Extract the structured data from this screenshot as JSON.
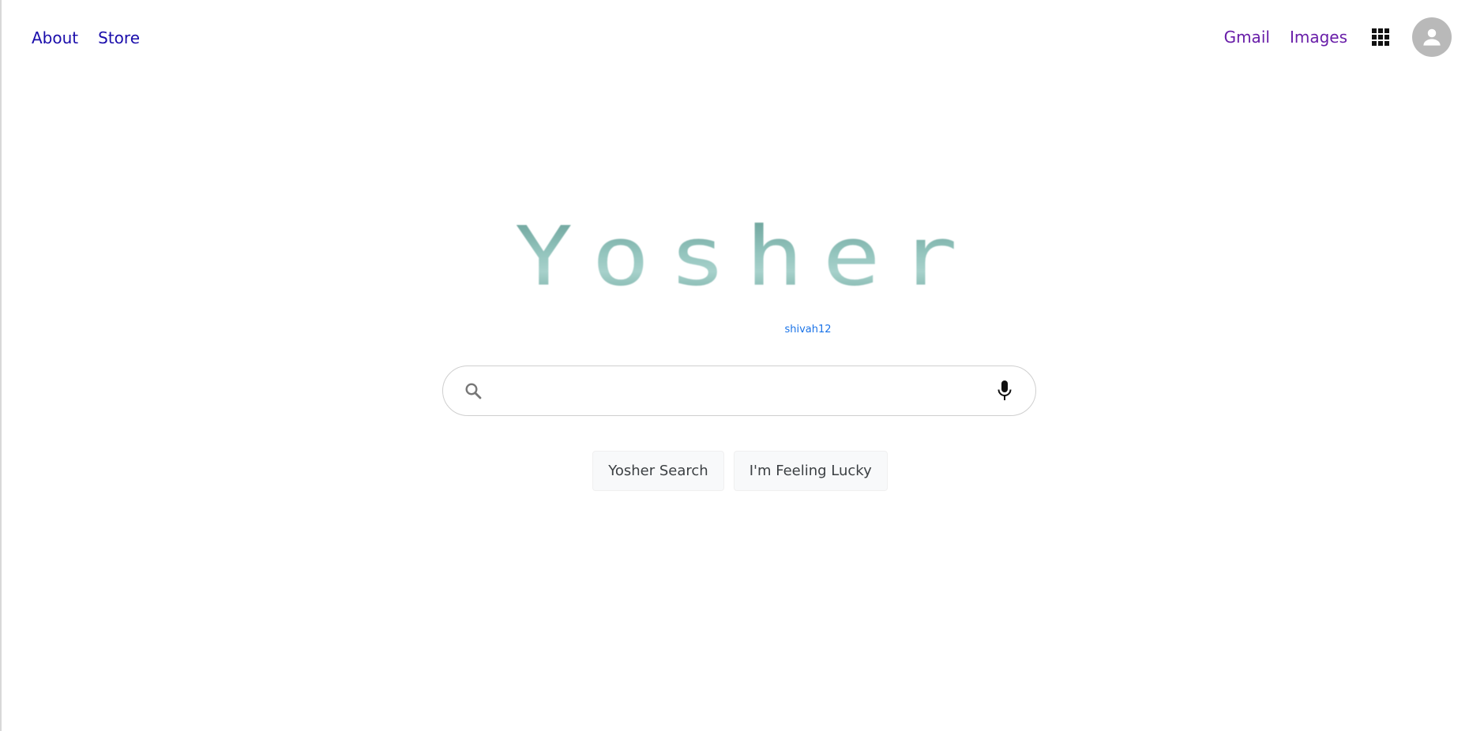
{
  "top_nav": {
    "about_label": "About",
    "store_label": "Store",
    "gmail_label": "Gmail",
    "images_label": "Images",
    "apps_icon": "apps-grid-icon",
    "avatar_icon": "account-icon"
  },
  "logo": {
    "text": "Yosher",
    "subtitle": "shivah12"
  },
  "search": {
    "value": "",
    "placeholder": "",
    "search_icon": "search-icon",
    "mic_icon": "microphone-icon"
  },
  "buttons": {
    "search_label": "Yosher Search",
    "lucky_label": "I'm Feeling Lucky"
  },
  "colors": {
    "link_blue": "#1a0dab",
    "link_visited": "#681da8",
    "subtitle_blue": "#1a73e8",
    "logo_teal": "#8fbdb6"
  }
}
